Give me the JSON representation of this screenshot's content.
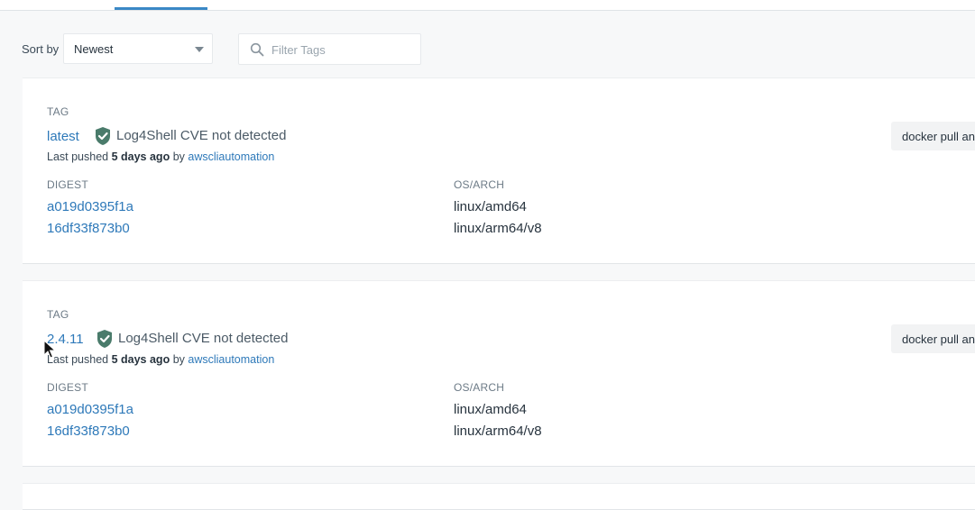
{
  "sort": {
    "label": "Sort by",
    "value": "Newest"
  },
  "filter": {
    "placeholder": "Filter Tags"
  },
  "colors": {
    "link": "#2e79b9",
    "shield": "#4a7b6b",
    "accent": "#3a88c6"
  },
  "icons": {
    "search": "search-icon",
    "shield": "shield-check-icon",
    "caret": "chevron-down-icon",
    "cursor": "mouse-pointer-icon"
  },
  "tags": [
    {
      "tag_label": "TAG",
      "name": "latest",
      "cve": "Log4Shell CVE not detected",
      "pushed_prefix": "Last pushed",
      "pushed_time": "5 days ago",
      "pushed_by": "by",
      "pushed_user": "awscliautomation",
      "pull_label": "docker pull an",
      "digest_header": "DIGEST",
      "arch_header": "OS/ARCH",
      "rows": [
        {
          "digest": "a019d0395f1a",
          "arch": "linux/amd64"
        },
        {
          "digest": "16df33f873b0",
          "arch": "linux/arm64/v8"
        }
      ]
    },
    {
      "tag_label": "TAG",
      "name": "2.4.11",
      "cve": "Log4Shell CVE not detected",
      "pushed_prefix": "Last pushed",
      "pushed_time": "5 days ago",
      "pushed_by": "by",
      "pushed_user": "awscliautomation",
      "pull_label": "docker pull an",
      "digest_header": "DIGEST",
      "arch_header": "OS/ARCH",
      "rows": [
        {
          "digest": "a019d0395f1a",
          "arch": "linux/amd64"
        },
        {
          "digest": "16df33f873b0",
          "arch": "linux/arm64/v8"
        }
      ]
    }
  ]
}
